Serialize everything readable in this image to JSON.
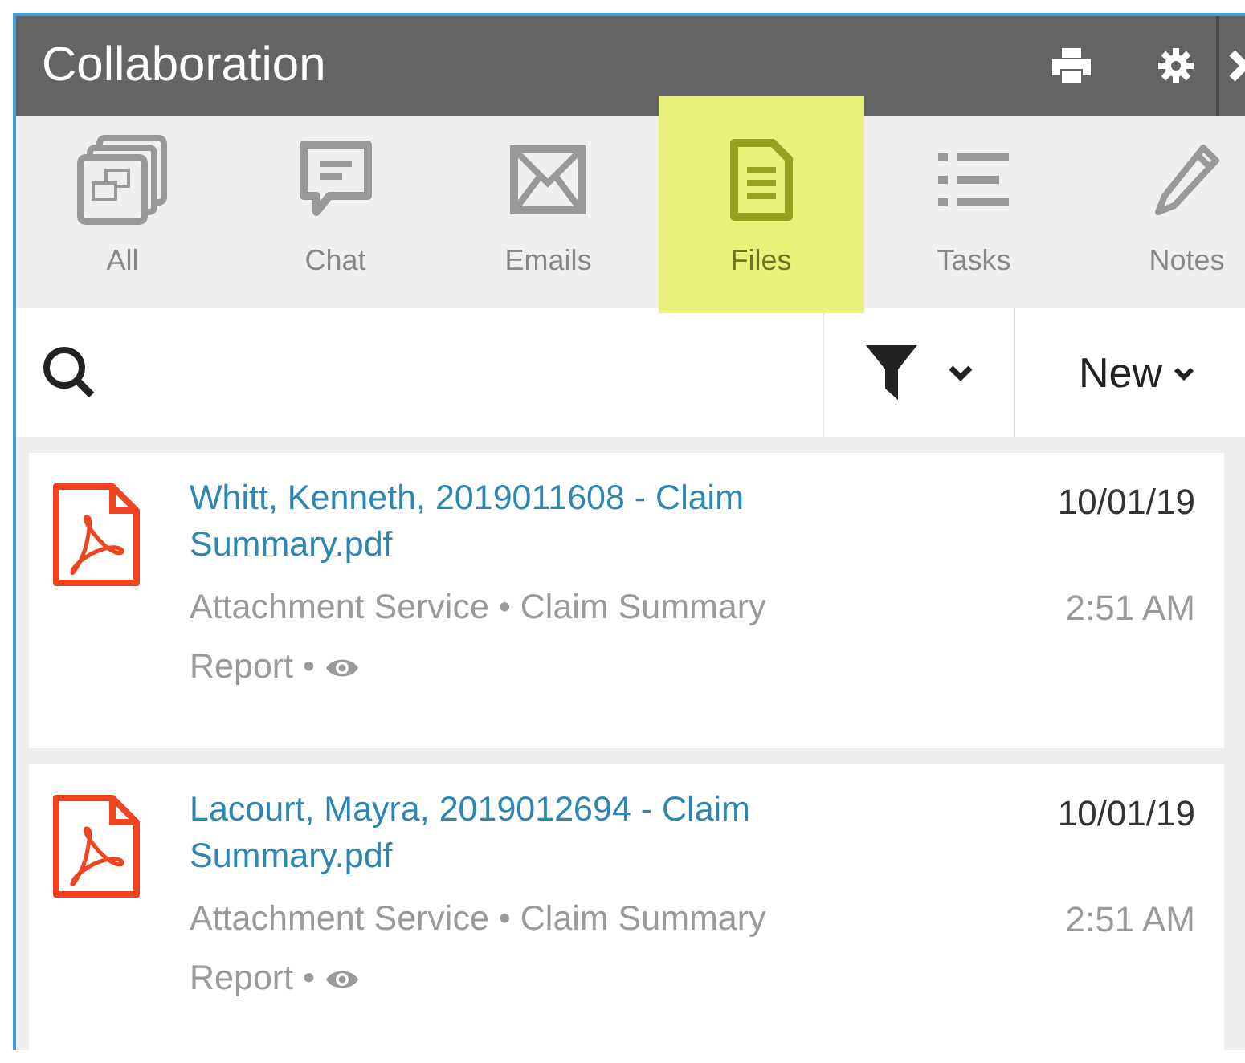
{
  "window": {
    "title": "Collaboration"
  },
  "tabs": [
    {
      "label": "All",
      "kind": "all",
      "selected": false
    },
    {
      "label": "Chat",
      "kind": "chat",
      "selected": false
    },
    {
      "label": "Emails",
      "kind": "emails",
      "selected": false
    },
    {
      "label": "Files",
      "kind": "files",
      "selected": true
    },
    {
      "label": "Tasks",
      "kind": "tasks",
      "selected": false
    },
    {
      "label": "Notes",
      "kind": "notes",
      "selected": false
    }
  ],
  "toolbar": {
    "new_button": "New"
  },
  "files": [
    {
      "title": "Whitt, Kenneth, 2019011608 - Claim Summary.pdf",
      "date": "10/01/19",
      "time": "2:51 AM",
      "meta_lines": [
        "Attachment Service • Claim Summary",
        "Report •"
      ]
    },
    {
      "title": "Lacourt, Mayra, 2019012694 - Claim Summary.pdf",
      "date": "10/01/19",
      "time": "2:51 AM",
      "meta_lines": [
        "Attachment Service • Claim Summary",
        "Report •"
      ]
    }
  ]
}
